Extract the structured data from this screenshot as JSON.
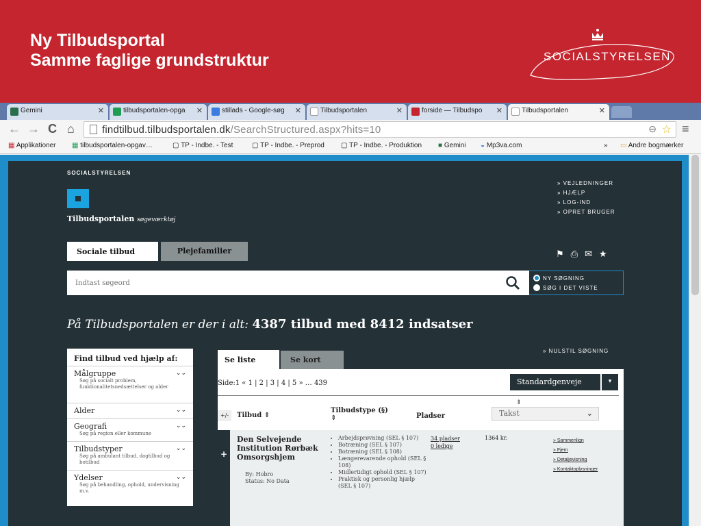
{
  "slide": {
    "title_line1": "Ny Tilbudsportal",
    "title_line2": "Samme faglige grundstruktur",
    "logo_text": "SOCIALSTYRELSEN",
    "colors": {
      "banner": "#c4252f"
    }
  },
  "browser": {
    "tabs": [
      {
        "label": "Gemini",
        "icon": "gemini-icon"
      },
      {
        "label": "tilbudsportalen-opga",
        "icon": "sheets-icon"
      },
      {
        "label": "stillads - Google-søg",
        "icon": "google-icon"
      },
      {
        "label": "Tilbudsportalen",
        "icon": "page-icon"
      },
      {
        "label": "forside — Tilbudspo",
        "icon": "crown-icon"
      },
      {
        "label": "Tilbudsportalen",
        "icon": "page-icon"
      }
    ],
    "url_host": "findtilbud.tilbudsportalen.dk",
    "url_path": "/SearchStructured.aspx?hits=10",
    "bookmarks": [
      "Applikationer",
      "tilbudsportalen-opgav…",
      "TP - Indbe. - Test",
      "TP - Indbe. - Preprod",
      "TP - Indbe. - Produktion",
      "Gemini",
      "Mp3va.com",
      "»",
      "Andre bogmærker"
    ]
  },
  "site": {
    "brand_small": "SOCIALSTYRELSEN",
    "brand_name": "Tilbudsportalen",
    "brand_sub": "søgeværktøj",
    "top_links": [
      "» VEJLEDNINGER",
      "» HJÆLP",
      "» LOG-IND",
      "» OPRET BRUGER"
    ],
    "tabs": [
      "Sociale tilbud",
      "Plejefamilier"
    ],
    "search_placeholder": "Indtast søgeord",
    "search_options": [
      "NY SØGNING",
      "SØG I DET VISTE"
    ],
    "count_prefix": "På Tilbudsportalen er der i alt:",
    "count_bold": "4387 tilbud med 8412 indsatser",
    "filter_title": "Find tilbud ved hjælp af:",
    "filters": [
      {
        "label": "Målgruppe",
        "sub": "Søg på socialt problem, funktionalitetsnedsættelser og alder"
      },
      {
        "label": "Alder",
        "sub": ""
      },
      {
        "label": "Geografi",
        "sub": "Søg på region eller kommune"
      },
      {
        "label": "Tilbudstyper",
        "sub": "Søg på ambulant tilbud, dagtilbud og botilbud"
      },
      {
        "label": "Ydelser",
        "sub": "Søg på behandling, ophold, undervisning m.v."
      }
    ],
    "result_tabs": [
      "Se liste",
      "Se kort"
    ],
    "nulstil": "» NULSTIL SØGNING",
    "pager": "Side:1 « 1 | 2 | 3 | 4 | 5 » … 439",
    "sort_label": "Standardgenveje",
    "headers": {
      "plusminus": "+/-",
      "tilbud": "Tilbud",
      "tilbudstype": "Tilbudstype (§)",
      "pladser": "Pladser",
      "takst": "Takst"
    },
    "row": {
      "name": "Den Selvejende Institution Rørbæk Omsorgshjem",
      "by": "By: Hobro",
      "status": "Status: No Data",
      "types": [
        "Arbejdsprøvning (SEL § 107)",
        "Botræning (SEL § 107)",
        "Botræning (SEL § 108)",
        "Længerevarende ophold (SEL § 108)",
        "Midlertidigt ophold (SEL § 107)",
        "Praktisk og personlig hjælp (SEL § 107)"
      ],
      "pladser": "34 pladser",
      "ledige": "0 ledige",
      "pris": "1364 kr.",
      "links": [
        "» Sammenlign",
        "» Fjern",
        "» Detaljevisning",
        "» Kontaktoplysninger"
      ]
    }
  }
}
